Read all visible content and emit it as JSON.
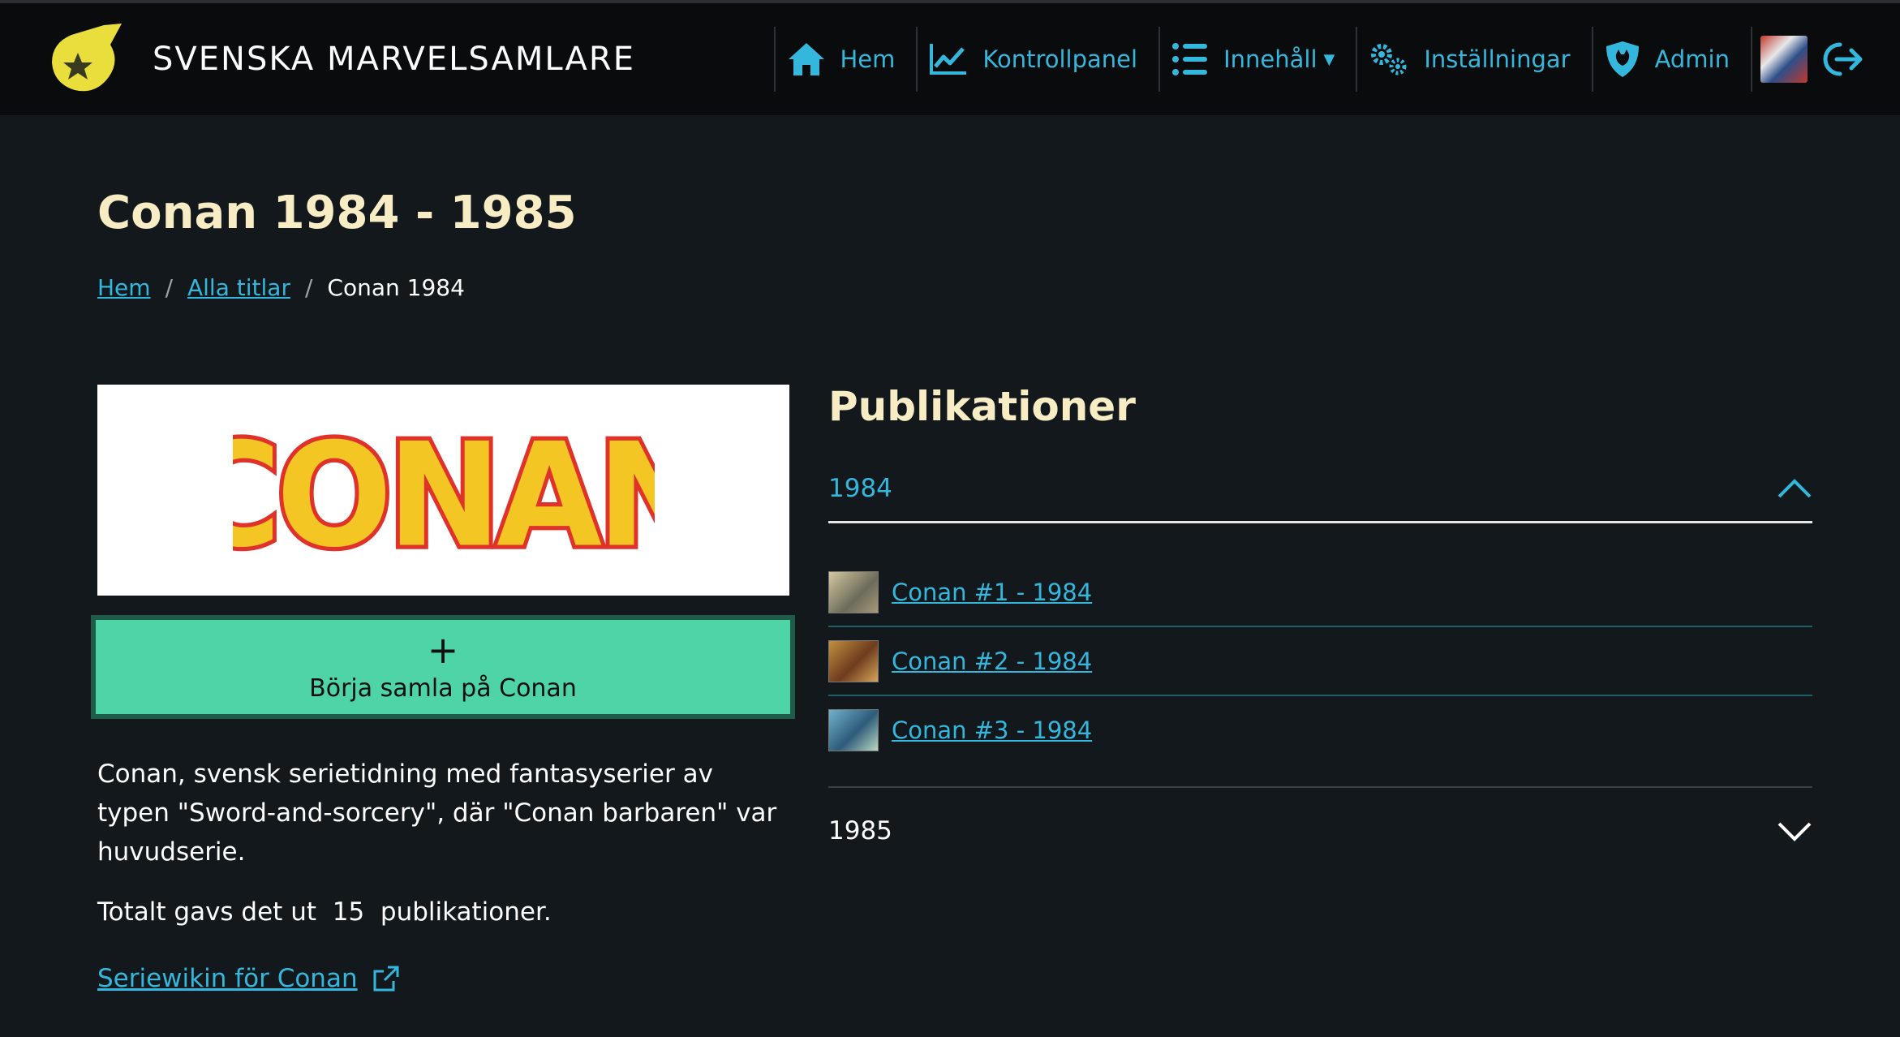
{
  "brand": {
    "name": "SVENSKA MARVELSAMLARE",
    "logo_icon": "star-badge-icon"
  },
  "nav": {
    "home": "Hem",
    "dashboard": "Kontrollpanel",
    "content": "Innehåll",
    "settings": "Inställningar",
    "admin": "Admin"
  },
  "page": {
    "title": "Conan 1984 - 1985",
    "breadcrumb": {
      "home": "Hem",
      "all": "Alla titlar",
      "current": "Conan 1984"
    }
  },
  "cover": {
    "logo_text": "CONAN"
  },
  "collect": {
    "plus": "+",
    "label": "Börja samla på Conan"
  },
  "description": "Conan, svensk serietidning med fantasyserier av typen \"Sword-and-sorcery\", där \"Conan barbaren\" var huvudserie.",
  "total": {
    "prefix": "Totalt gavs det ut",
    "count": "15",
    "suffix": "publikationer."
  },
  "wiki_link": "Seriewikin för Conan",
  "publications": {
    "heading": "Publikationer",
    "years": [
      {
        "year": "1984",
        "expanded": true,
        "items": [
          "Conan #1 - 1984",
          "Conan #2 - 1984",
          "Conan #3 - 1984"
        ]
      },
      {
        "year": "1985",
        "expanded": false
      }
    ]
  },
  "colors": {
    "accent": "#34b7dd",
    "heading": "#f7ecc4",
    "button": "#4fd4a8",
    "background": "#12181b"
  }
}
